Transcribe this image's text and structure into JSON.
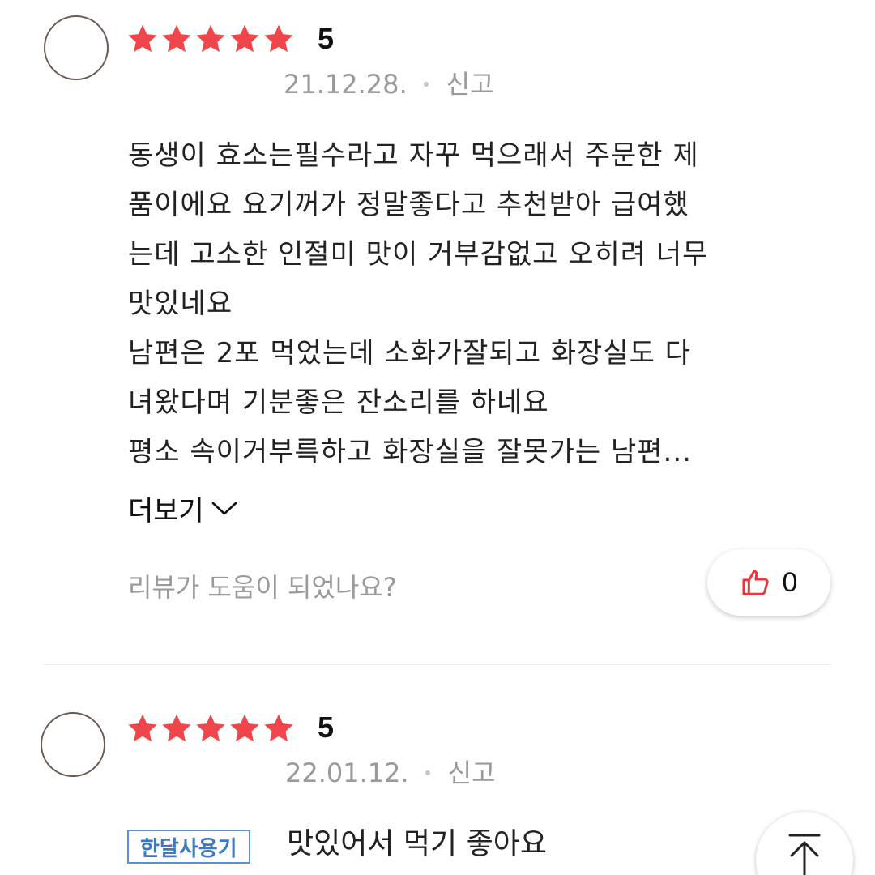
{
  "reviews": [
    {
      "rating": "5",
      "date": "21.12.28.",
      "report_label": "신고",
      "text": "동생이 효소는필수라고 자꾸 먹으래서 주문한 제\n품이에요 요기꺼가 정말좋다고 추천받아 급여했\n는데 고소한 인절미 맛이 거부감없고 오히려 너무\n맛있네요\n남편은 2포 먹었는데 소화가잘되고 화장실도 다\n녀왔다며 기분좋은 잔소리를 하네요\n평소 속이거부륵하고 화장실을 잘못가는 남편...",
      "more_label": "더보기",
      "helpful_question": "리뷰가 도움이 되었나요?",
      "like_count": "0"
    },
    {
      "rating": "5",
      "date": "22.01.12.",
      "report_label": "신고",
      "tag": "한달사용기",
      "text": "맛있어서 먹기 좋아요"
    }
  ],
  "colors": {
    "star": "#f0454b",
    "thumb": "#e8383d",
    "tag_border": "#5b8fd1",
    "tag_text": "#3c78c4",
    "meta_text": "#9a9a9a"
  },
  "icons": {
    "star": "star-icon",
    "like": "thumbs-up-icon",
    "more": "chevron-down-icon",
    "scroll_top": "arrow-up-icon"
  }
}
